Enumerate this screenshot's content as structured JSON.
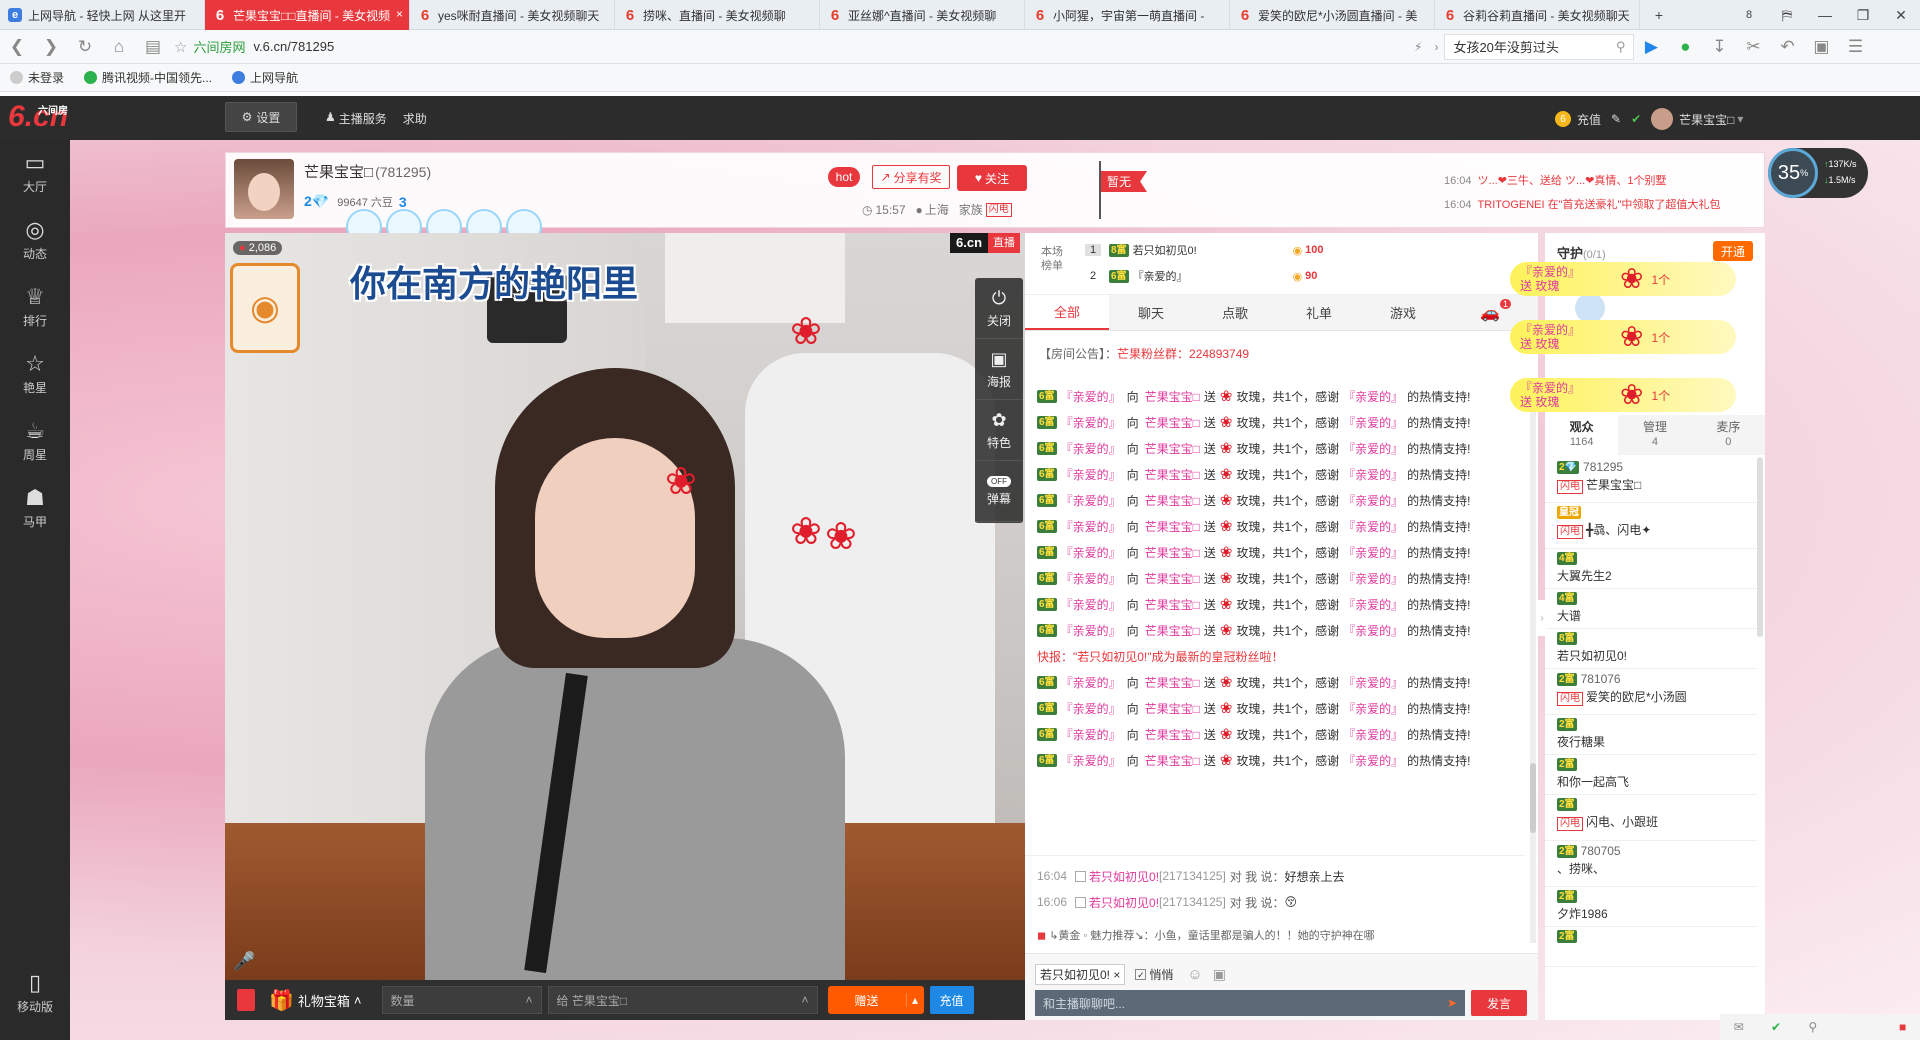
{
  "browser": {
    "tabs": [
      {
        "title": "上网导航 - 轻快上网 从这里开",
        "icon": "ie"
      },
      {
        "title": "芒果宝宝□□直播间 - 美女视频",
        "icon": "six",
        "active": true
      },
      {
        "title": "yes咪耐直播间 - 美女视频聊天",
        "icon": "six"
      },
      {
        "title": "捞咪、直播间 - 美女视频聊",
        "icon": "six"
      },
      {
        "title": "亚丝娜^直播间 - 美女视频聊",
        "icon": "six"
      },
      {
        "title": "小阿猩，宇宙第一萌直播间 -",
        "icon": "six"
      },
      {
        "title": "爱笑的欧尼*小汤圆直播间 - 美",
        "icon": "six"
      },
      {
        "title": "谷莉谷莉直播间 - 美女视频聊天",
        "icon": "six"
      }
    ],
    "tab_count": "8",
    "site_name": "六间房网",
    "url": "v.6.cn/781295",
    "search_text": "女孩20年没剪过头",
    "bookmarks": [
      "未登录",
      "腾讯视频-中国领先...",
      "上网导航"
    ]
  },
  "site": {
    "logo_text": "6.cn",
    "logo_sub": "六间房",
    "settings": "设置",
    "host_service": "主播服务",
    "help": "求助",
    "recharge": "充值",
    "username": "芒果宝宝□"
  },
  "sidebar": [
    {
      "label": "大厅",
      "icon": "tv-icon"
    },
    {
      "label": "动态",
      "icon": "compass-icon"
    },
    {
      "label": "排行",
      "icon": "crown-icon"
    },
    {
      "label": "艳星",
      "icon": "star-icon"
    },
    {
      "label": "周星",
      "icon": "cup-icon"
    },
    {
      "label": "马甲",
      "icon": "shirt-icon"
    }
  ],
  "sidebar_mobile": "移动版",
  "streamer": {
    "name": "芒果宝宝□",
    "id": "(781295)",
    "level": "2",
    "beans": "99647 六豆",
    "level_next": "3",
    "hot": "hot",
    "share": "分享有奖",
    "follow": "关注",
    "time": "15:57",
    "city": "上海",
    "family": "家族",
    "family_tag": "闪电",
    "flag": "暂无",
    "events": [
      {
        "time": "16:04",
        "text": "ツ...❤三牛、送给 ツ...❤真情、1个别墅"
      },
      {
        "time": "16:04",
        "text": "TRITOGENEI 在\"首充送豪礼\"中领取了超值大礼包"
      }
    ]
  },
  "speed": {
    "percent": "35",
    "unit": "%",
    "up": "137K/s",
    "down": "1.5M/s"
  },
  "video": {
    "lyric": "你在南方的艳阳里",
    "viewers": "2,086",
    "live_logo": "6.cn",
    "live_label": "直播",
    "tools": [
      {
        "label": "关闭",
        "icon": "power-icon"
      },
      {
        "label": "海报",
        "icon": "poster-icon"
      },
      {
        "label": "特色",
        "icon": "feature-icon"
      },
      {
        "label": "弹幕",
        "icon": "danmaku-toggle-icon",
        "toggle": "OFF"
      }
    ]
  },
  "giftbar": {
    "gift_box": "礼物宝箱",
    "quantity_placeholder": "数量",
    "to": "给 芒果宝宝□",
    "send": "赠送",
    "recharge": "充值"
  },
  "rank": {
    "label": "本场榜单",
    "rows": [
      {
        "pos": "1",
        "level": "8富",
        "name": "若只如初见0!",
        "score": "100"
      },
      {
        "pos": "2",
        "level": "6富",
        "name": "『亲爱的』",
        "score": "90"
      }
    ]
  },
  "chat": {
    "tabs": [
      "全部",
      "聊天",
      "点歌",
      "礼单",
      "游戏"
    ],
    "notice_label": "【房间公告】：",
    "notice_text": "芒果粉丝群：224893749",
    "gift_msg": {
      "level": "6富",
      "sender": "『亲爱的』",
      "to": "向",
      "receiver": "芒果宝宝□",
      "send": "送",
      "item": "玫瑰，共1个，感谢",
      "thanks_to": "『亲爱的』",
      "thanks": "的热情支持!"
    },
    "gift_repeat": 14,
    "flash_news": "快报：\"若只如初见0!\"成为最新的皇冠粉丝啦！",
    "messages": [
      {
        "time": "16:04",
        "user": "若只如初见0!",
        "uid": "[217134125]",
        "action": "对 我 说：",
        "text": "好想亲上去"
      },
      {
        "time": "16:06",
        "user": "若只如初见0!",
        "uid": "[217134125]",
        "action": "对 我 说：",
        "text": "😚"
      }
    ],
    "system": "↳黄金 ◦ 魅力推荐↘：小鱼，童话里都是骗人的！！她的守护神在哪",
    "target": "若只如初见0!",
    "quiet": "悄悄",
    "input_placeholder": "和主播聊聊吧...",
    "send": "发言"
  },
  "guard": {
    "title": "守护",
    "count": "(0/1)",
    "open": "开通"
  },
  "gift_notes": [
    {
      "from": "『亲爱的』",
      "action": "送 玫瑰",
      "count": "1个"
    },
    {
      "from": "『亲爱的』",
      "action": "送 玫瑰",
      "count": "1个"
    },
    {
      "from": "『亲爱的』",
      "action": "送 玫瑰",
      "count": "1个"
    }
  ],
  "audience": {
    "tabs": [
      {
        "label": "观众",
        "count": "1164"
      },
      {
        "label": "管理",
        "count": "4"
      },
      {
        "label": "麦序",
        "count": "0"
      }
    ],
    "users": [
      {
        "badge": "2💎",
        "name": "781295",
        "line2": "芒果宝宝□",
        "flash": true
      },
      {
        "badge": "皇冠",
        "name": "",
        "line2": "╋骉、闪电✦",
        "flash": true
      },
      {
        "badge": "4富",
        "name": "大翼先生2"
      },
      {
        "badge": "4富",
        "name": "大谱"
      },
      {
        "badge": "8富",
        "name": "若只如初见0!"
      },
      {
        "badge": "2富",
        "name": "781076",
        "line2": "爱笑的欧尼*小汤圆",
        "flash": true
      },
      {
        "badge": "2富",
        "name": "夜行糖果"
      },
      {
        "badge": "2富",
        "name": "和你一起高飞"
      },
      {
        "badge": "2富",
        "name": "",
        "line2": "闪电、小跟班",
        "flash": true
      },
      {
        "badge": "2富",
        "name": "780705",
        "line2": "、捞咪、"
      },
      {
        "badge": "2富",
        "name": "夕炸1986"
      },
      {
        "badge": "2富",
        "name": ""
      }
    ]
  }
}
